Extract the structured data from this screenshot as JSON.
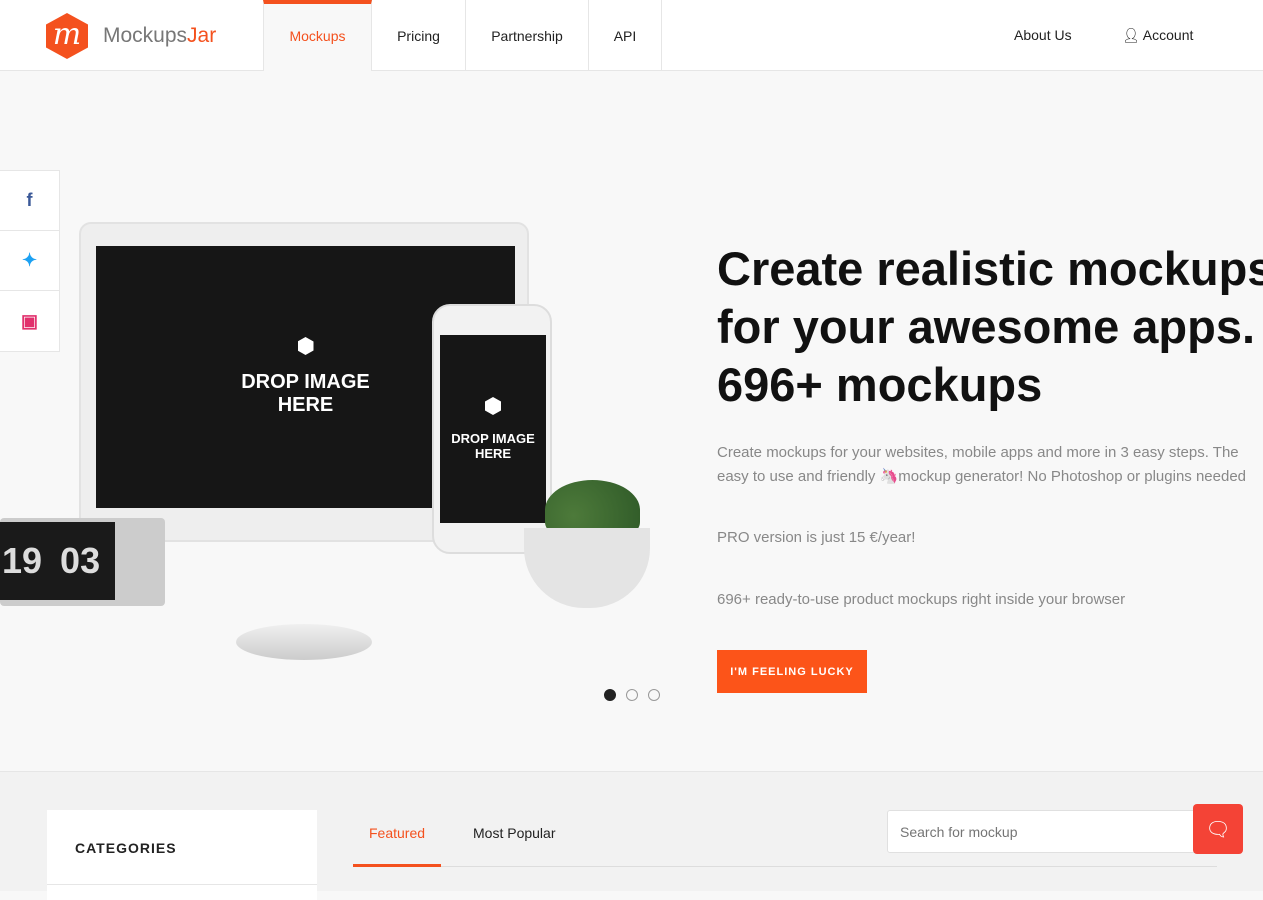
{
  "header": {
    "logo_letter": "m",
    "brand_a": "Mockups",
    "brand_b": "Jar",
    "nav": [
      "Mockups",
      "Pricing",
      "Partnership",
      "API"
    ],
    "about": "About Us",
    "account": "Account"
  },
  "social": [
    "f",
    "t",
    "ig"
  ],
  "hero": {
    "drop_label_1": "DROP IMAGE",
    "drop_label_2": "HERE",
    "clock_1": "19",
    "clock_2": "03",
    "title_1": "Create realistic mockups",
    "title_2": "for your awesome apps.",
    "title_3": "696+ mockups",
    "desc_1": "Create mockups for your websites, mobile apps and more in 3 easy steps. The",
    "desc_2": "easy to use and friendly 🦄mockup generator! No Photoshop or plugins needed",
    "pro": "PRO version is just 15 €/year!",
    "ready": "696+ ready-to-use product mockups right inside your browser",
    "cta": "I'M FEELING LUCKY",
    "slide_active": 1,
    "slide_count": 3
  },
  "lower": {
    "categories": "CATEGORIES",
    "tab_featured": "Featured",
    "tab_popular": "Most Popular",
    "search_placeholder": "Search for mockup"
  },
  "colors": {
    "accent": "#f4511e",
    "chat": "#f44336"
  }
}
